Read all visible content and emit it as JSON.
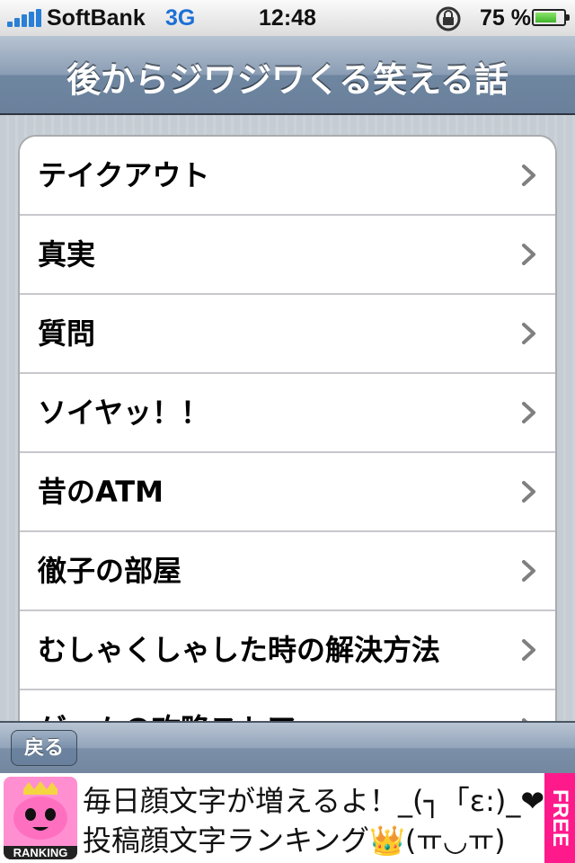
{
  "status_bar": {
    "carrier": "SoftBank",
    "network": "3G",
    "time": "12:48",
    "battery_text": "75 %",
    "battery_level": 0.75
  },
  "navbar": {
    "title": "後からジワジワくる笑える話"
  },
  "list": {
    "items": [
      {
        "label": "テイクアウト"
      },
      {
        "label": "真実"
      },
      {
        "label": "質問"
      },
      {
        "label": "ソイヤッ！！"
      },
      {
        "label": "昔のATM"
      },
      {
        "label": "徹子の部屋"
      },
      {
        "label": "むしゃくしゃした時の解決方法"
      },
      {
        "label": "ゲームの攻略ストア"
      }
    ]
  },
  "toolbar": {
    "back_label": "戻る"
  },
  "ad": {
    "ranking_label": "RANKING",
    "line1": "毎日顔文字が増えるよ！_(┐「ε:)_❤",
    "line2": "投稿顔文字ランキング👑(ￗ◡ￗ)",
    "free_label": "FREE"
  },
  "colors": {
    "accent_blue": "#1c6fd6",
    "navbar": "#6f86a1",
    "ad_pink": "#ff1a8c"
  }
}
